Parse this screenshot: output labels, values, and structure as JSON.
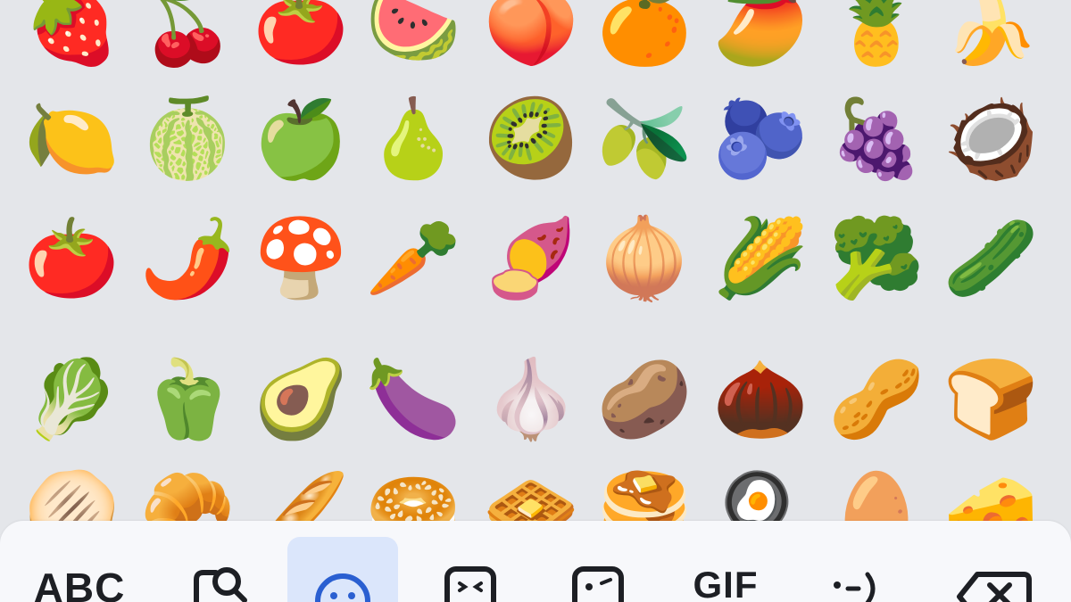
{
  "emoji_rows": [
    [
      "🍓",
      "🍒",
      "🍅",
      "🍉",
      "🍑",
      "🍊",
      "🥭",
      "🍍",
      "🍌"
    ],
    [
      "🍋",
      "🍈",
      "🍏",
      "🍐",
      "🥝",
      "🫒",
      "🫐",
      "🍇",
      "🥥"
    ],
    [
      "🍅",
      "🌶️",
      "🍄",
      "🥕",
      "🍠",
      "🧅",
      "🌽",
      "🥦",
      "🥒"
    ],
    [
      "🥬",
      "🫑",
      "🥑",
      "🍆",
      "🧄",
      "🥔",
      "🌰",
      "🥜",
      "🍞"
    ],
    [
      "🫓",
      "🥐",
      "🥖",
      "🥯",
      "🧇",
      "🥞",
      "🍳",
      "🥚",
      "🧀"
    ]
  ],
  "bottom_bar": {
    "abc_label": "ABC",
    "gif_label": "GIF",
    "active_tab": "emoji",
    "active_color": "#dbe6fb",
    "icon_color": "#1d1f24",
    "active_icon_color": "#2a5fd1",
    "tabs": [
      {
        "id": "abc",
        "icon": "text-label"
      },
      {
        "id": "emoji-search",
        "icon": "emoji-search-icon"
      },
      {
        "id": "emoji",
        "icon": "smiley-face-icon"
      },
      {
        "id": "sticker",
        "icon": "sticker-face-icon"
      },
      {
        "id": "bitmoji",
        "icon": "winking-sticker-icon"
      },
      {
        "id": "gif",
        "icon": "text-label"
      },
      {
        "id": "emoticon",
        "icon": "emoticon-icon"
      },
      {
        "id": "backspace",
        "icon": "backspace-icon"
      }
    ]
  }
}
